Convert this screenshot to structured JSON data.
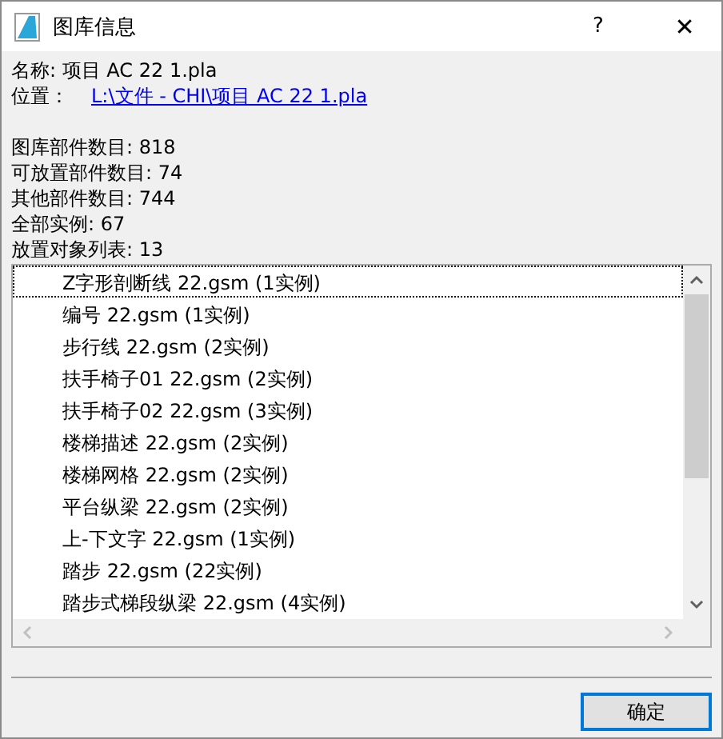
{
  "window": {
    "title": "图库信息",
    "help": "?",
    "close": "✕"
  },
  "name_line": "名称: 项目 AC 22 1.pla",
  "location": {
    "label": "位置：",
    "link": "L:\\文件 - CHI\\项目 AC 22 1.pla"
  },
  "stats": [
    "图库部件数目: 818",
    "可放置部件数目: 74",
    "其他部件数目: 744",
    "全部实例: 67",
    "放置对象列表: 13"
  ],
  "list": {
    "items": [
      {
        "text": "Z字形剖断线 22.gsm (1实例)",
        "focused": true
      },
      {
        "text": "编号 22.gsm (1实例)",
        "focused": false
      },
      {
        "text": "步行线 22.gsm (2实例)",
        "focused": false
      },
      {
        "text": "扶手椅子01 22.gsm (2实例)",
        "focused": false
      },
      {
        "text": "扶手椅子02 22.gsm (3实例)",
        "focused": false
      },
      {
        "text": "楼梯描述 22.gsm (2实例)",
        "focused": false
      },
      {
        "text": "楼梯网格 22.gsm (2实例)",
        "focused": false
      },
      {
        "text": "平台纵梁 22.gsm (2实例)",
        "focused": false
      },
      {
        "text": "上-下文字 22.gsm (1实例)",
        "focused": false
      },
      {
        "text": "踏步 22.gsm (22实例)",
        "focused": false
      },
      {
        "text": "踏步式梯段纵梁 22.gsm (4实例)",
        "focused": false
      }
    ]
  },
  "buttons": [
    {
      "label": "确定",
      "default": true
    }
  ]
}
